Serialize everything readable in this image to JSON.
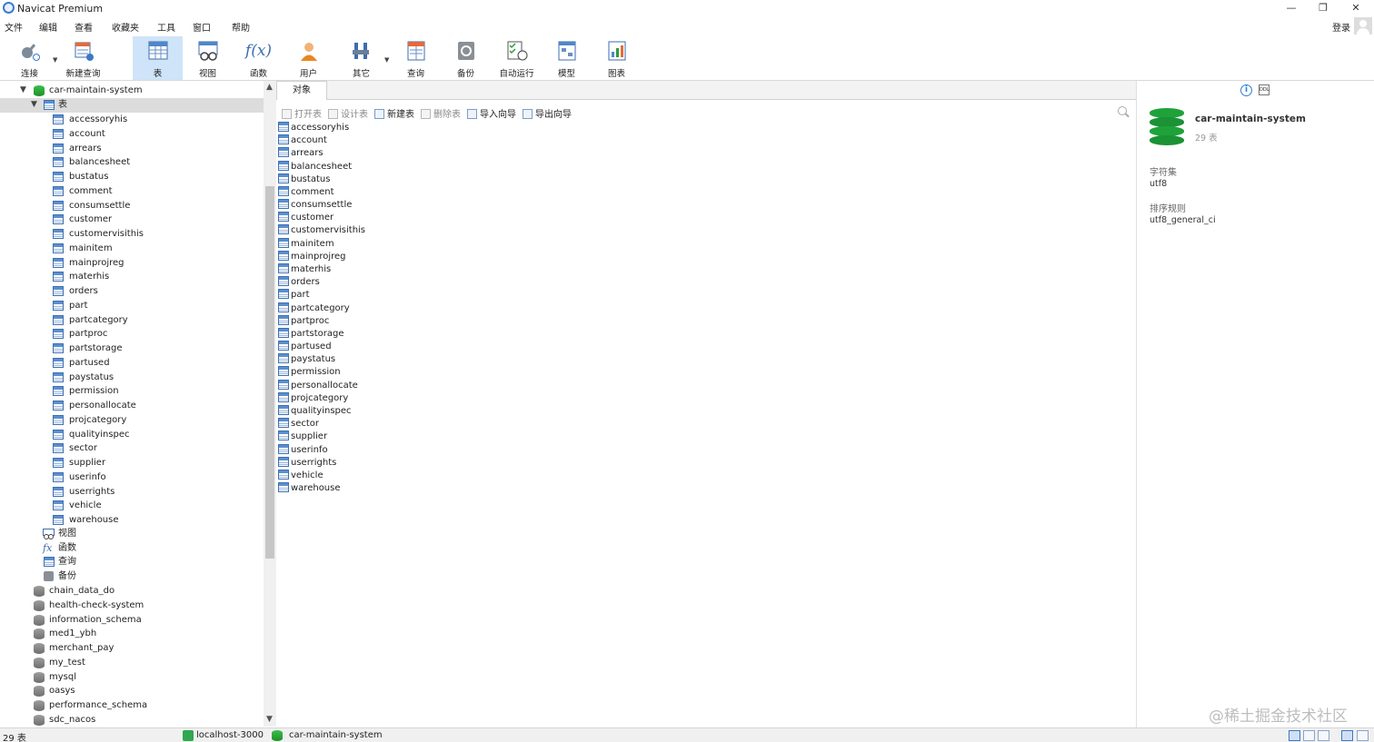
{
  "window": {
    "title": "Navicat Premium",
    "controls": [
      "—",
      "❐",
      "✕"
    ]
  },
  "menu": {
    "items": [
      "文件",
      "编辑",
      "查看",
      "收藏夹",
      "工具",
      "窗口",
      "帮助"
    ],
    "login": "登录"
  },
  "toolbar": {
    "buttons": [
      {
        "label": "连接",
        "icon": "plug-icon"
      },
      {
        "label": "新建查询",
        "icon": "new-query-icon"
      },
      {
        "label": "表",
        "icon": "table-icon"
      },
      {
        "label": "视图",
        "icon": "view-icon"
      },
      {
        "label": "函数",
        "icon": "function-icon"
      },
      {
        "label": "用户",
        "icon": "user-icon"
      },
      {
        "label": "其它",
        "icon": "tools-icon"
      },
      {
        "label": "查询",
        "icon": "query-icon"
      },
      {
        "label": "备份",
        "icon": "backup-icon"
      },
      {
        "label": "自动运行",
        "icon": "automation-icon"
      },
      {
        "label": "模型",
        "icon": "model-icon"
      },
      {
        "label": "图表",
        "icon": "chart-icon"
      }
    ],
    "active": "表"
  },
  "tree": {
    "database": "car-maintain-system",
    "tables_node": "表",
    "tables": [
      "accessoryhis",
      "account",
      "arrears",
      "balancesheet",
      "bustatus",
      "comment",
      "consumsettle",
      "customer",
      "customervisithis",
      "mainitem",
      "mainprojreg",
      "materhis",
      "orders",
      "part",
      "partcategory",
      "partproc",
      "partstorage",
      "partused",
      "paystatus",
      "permission",
      "personallocate",
      "projcategory",
      "qualityinspec",
      "sector",
      "supplier",
      "userinfo",
      "userrights",
      "vehicle",
      "warehouse"
    ],
    "other_nodes": [
      "视图",
      "函数",
      "查询",
      "备份"
    ],
    "other_databases": [
      "chain_data_do",
      "health-check-system",
      "information_schema",
      "med1_ybh",
      "merchant_pay",
      "my_test",
      "mysql",
      "oasys",
      "performance_schema",
      "sdc_nacos"
    ]
  },
  "objects": {
    "tab": "对象",
    "actions": [
      {
        "label": "打开表",
        "enabled": false
      },
      {
        "label": "设计表",
        "enabled": false
      },
      {
        "label": "新建表",
        "enabled": true
      },
      {
        "label": "删除表",
        "enabled": false
      },
      {
        "label": "导入向导",
        "enabled": true
      },
      {
        "label": "导出向导",
        "enabled": true
      }
    ],
    "list": [
      "accessoryhis",
      "account",
      "arrears",
      "balancesheet",
      "bustatus",
      "comment",
      "consumsettle",
      "customer",
      "customervisithis",
      "mainitem",
      "mainprojreg",
      "materhis",
      "orders",
      "part",
      "partcategory",
      "partproc",
      "partstorage",
      "partused",
      "paystatus",
      "permission",
      "personallocate",
      "projcategory",
      "qualityinspec",
      "sector",
      "supplier",
      "userinfo",
      "userrights",
      "vehicle",
      "warehouse"
    ]
  },
  "info": {
    "name": "car-maintain-system",
    "count": "29 表",
    "charset_label": "字符集",
    "charset": "utf8",
    "collation_label": "排序规则",
    "collation": "utf8_general_ci"
  },
  "watermark": "@稀土掘金技术社区",
  "status": {
    "count": "29 表",
    "connection": "localhost-3000",
    "database": "car-maintain-system"
  }
}
